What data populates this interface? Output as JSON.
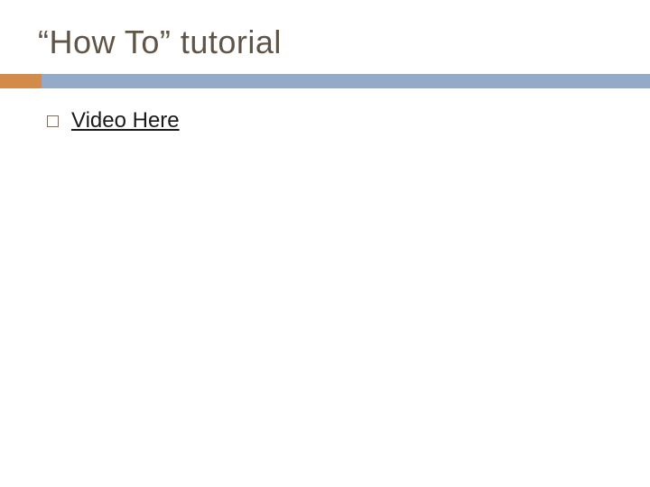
{
  "title": "“How To” tutorial",
  "colors": {
    "title": "#5f5447",
    "divider_accent": "#d38b4a",
    "divider_main": "#93aac8",
    "bullet_border": "#7a7065",
    "link": "#1a1a1a"
  },
  "body": {
    "items": [
      {
        "label": "Video Here"
      }
    ]
  }
}
